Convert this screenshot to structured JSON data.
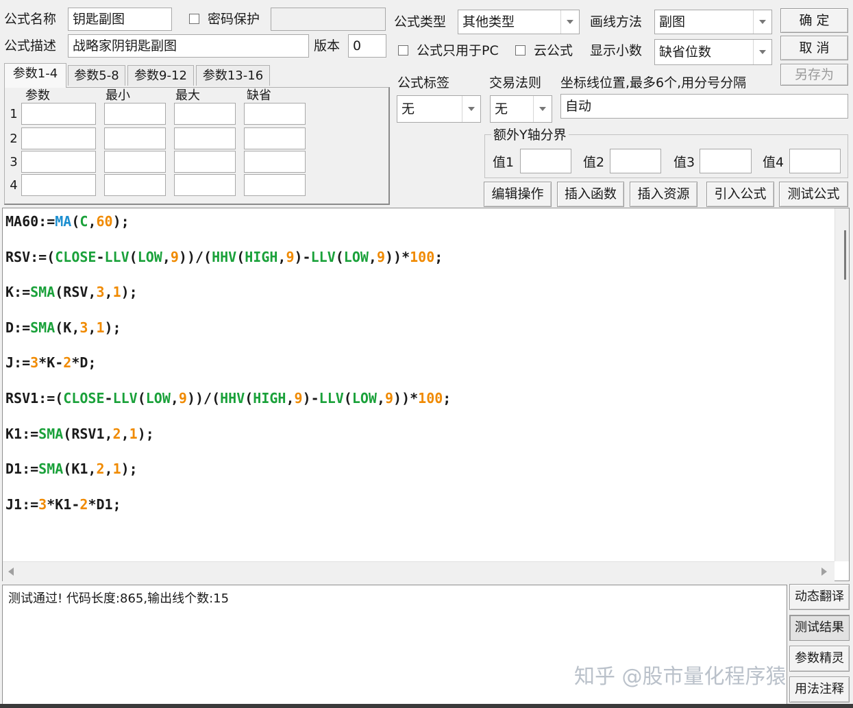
{
  "header": {
    "name_label": "公式名称",
    "name_value": "钥匙副图",
    "password_label": "密码保护",
    "desc_label": "公式描述",
    "desc_value": "战略家阴钥匙副图",
    "version_label": "版本",
    "version_value": "0",
    "type_label": "公式类型",
    "type_value": "其他类型",
    "draw_label": "画线方法",
    "draw_value": "副图",
    "pc_only_label": "公式只用于PC",
    "cloud_label": "云公式",
    "decimal_label": "显示小数",
    "decimal_value": "缺省位数"
  },
  "buttons": {
    "ok": "确  定",
    "cancel": "取  消",
    "save_as": "另存为"
  },
  "params": {
    "tabs": [
      "参数1-4",
      "参数5-8",
      "参数9-12",
      "参数13-16"
    ],
    "columns": [
      "参数",
      "最小",
      "最大",
      "缺省"
    ],
    "rows": [
      "1",
      "2",
      "3",
      "4"
    ]
  },
  "options": {
    "tag_label": "公式标签",
    "tag_value": "无",
    "rule_label": "交易法则",
    "rule_value": "无",
    "axis_label": "坐标线位置,最多6个,用分号分隔",
    "axis_value": "自动",
    "y_group_label": "额外Y轴分界",
    "y1_label": "值1",
    "y2_label": "值2",
    "y3_label": "值3",
    "y4_label": "值4"
  },
  "toolbar": {
    "edit": "编辑操作",
    "insert_func": "插入函数",
    "insert_res": "插入资源",
    "import": "引入公式",
    "test": "测试公式"
  },
  "code": [
    [
      [
        "MA60:=",
        ""
      ],
      [
        "MA",
        "fnb"
      ],
      [
        "(",
        ""
      ],
      [
        "C",
        "fn"
      ],
      [
        ",",
        ""
      ],
      [
        "60",
        "num"
      ],
      [
        ");",
        ""
      ]
    ],
    [
      [
        "RSV:=(",
        ""
      ],
      [
        "CLOSE",
        "fn"
      ],
      [
        "-",
        ""
      ],
      [
        "LLV",
        "fn"
      ],
      [
        "(",
        ""
      ],
      [
        "LOW",
        "fn"
      ],
      [
        ",",
        ""
      ],
      [
        "9",
        "num"
      ],
      [
        "))/(",
        ""
      ],
      [
        "HHV",
        "fn"
      ],
      [
        "(",
        ""
      ],
      [
        "HIGH",
        "fn"
      ],
      [
        ",",
        ""
      ],
      [
        "9",
        "num"
      ],
      [
        ")-",
        ""
      ],
      [
        "LLV",
        "fn"
      ],
      [
        "(",
        ""
      ],
      [
        "LOW",
        "fn"
      ],
      [
        ",",
        ""
      ],
      [
        "9",
        "num"
      ],
      [
        "))*",
        ""
      ],
      [
        "100",
        "num"
      ],
      [
        ";",
        ""
      ]
    ],
    [
      [
        "K:=",
        ""
      ],
      [
        "SMA",
        "fn"
      ],
      [
        "(RSV,",
        ""
      ],
      [
        "3",
        "num"
      ],
      [
        ",",
        ""
      ],
      [
        "1",
        "num"
      ],
      [
        ");",
        ""
      ]
    ],
    [
      [
        "D:=",
        ""
      ],
      [
        "SMA",
        "fn"
      ],
      [
        "(K,",
        ""
      ],
      [
        "3",
        "num"
      ],
      [
        ",",
        ""
      ],
      [
        "1",
        "num"
      ],
      [
        ");",
        ""
      ]
    ],
    [
      [
        "J:=",
        ""
      ],
      [
        "3",
        "num"
      ],
      [
        "*K-",
        ""
      ],
      [
        "2",
        "num"
      ],
      [
        "*D;",
        ""
      ]
    ],
    [
      [
        "RSV1:=(",
        ""
      ],
      [
        "CLOSE",
        "fn"
      ],
      [
        "-",
        ""
      ],
      [
        "LLV",
        "fn"
      ],
      [
        "(",
        ""
      ],
      [
        "LOW",
        "fn"
      ],
      [
        ",",
        ""
      ],
      [
        "9",
        "num"
      ],
      [
        "))/(",
        ""
      ],
      [
        "HHV",
        "fn"
      ],
      [
        "(",
        ""
      ],
      [
        "HIGH",
        "fn"
      ],
      [
        ",",
        ""
      ],
      [
        "9",
        "num"
      ],
      [
        ")-",
        ""
      ],
      [
        "LLV",
        "fn"
      ],
      [
        "(",
        ""
      ],
      [
        "LOW",
        "fn"
      ],
      [
        ",",
        ""
      ],
      [
        "9",
        "num"
      ],
      [
        "))*",
        ""
      ],
      [
        "100",
        "num"
      ],
      [
        ";",
        ""
      ]
    ],
    [
      [
        "K1:=",
        ""
      ],
      [
        "SMA",
        "fn"
      ],
      [
        "(RSV1,",
        ""
      ],
      [
        "2",
        "num"
      ],
      [
        ",",
        ""
      ],
      [
        "1",
        "num"
      ],
      [
        ");",
        ""
      ]
    ],
    [
      [
        "D1:=",
        ""
      ],
      [
        "SMA",
        "fn"
      ],
      [
        "(K1,",
        ""
      ],
      [
        "2",
        "num"
      ],
      [
        ",",
        ""
      ],
      [
        "1",
        "num"
      ],
      [
        ");",
        ""
      ]
    ],
    [
      [
        "J1:=",
        ""
      ],
      [
        "3",
        "num"
      ],
      [
        "*K1-",
        ""
      ],
      [
        "2",
        "num"
      ],
      [
        "*D1;",
        ""
      ]
    ]
  ],
  "output": {
    "message": "测试通过! 代码长度:865,输出线个数:15"
  },
  "side_buttons": {
    "translate": "动态翻译",
    "result": "测试结果",
    "wizard": "参数精灵",
    "notes": "用法注释"
  },
  "watermark": "知乎 @股市量化程序猿"
}
